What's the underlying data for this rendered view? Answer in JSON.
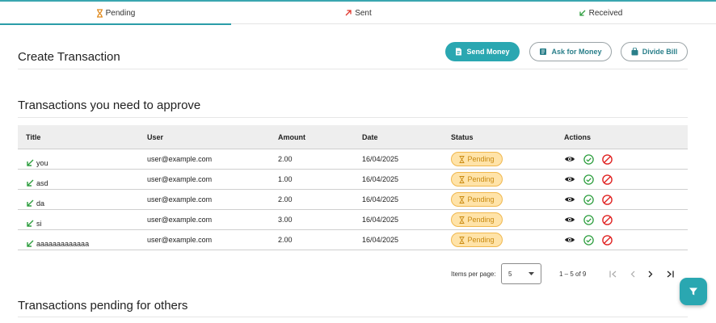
{
  "tabs": [
    {
      "label": "Pending",
      "icon": "hourglass-icon",
      "active": true
    },
    {
      "label": "Sent",
      "icon": "arrow-up-right-icon",
      "active": false
    },
    {
      "label": "Received",
      "icon": "arrow-down-left-icon",
      "active": false
    }
  ],
  "create": {
    "title": "Create Transaction",
    "send_label": "Send Money",
    "ask_label": "Ask for Money",
    "divide_label": "Divide Bill"
  },
  "approve": {
    "title": "Transactions you need to approve",
    "columns": [
      "Title",
      "User",
      "Amount",
      "Date",
      "Status",
      "Actions"
    ],
    "rows": [
      {
        "title": "you",
        "user": "user@example.com",
        "amount": "2.00",
        "date": "16/04/2025",
        "status": "Pending"
      },
      {
        "title": "asd",
        "user": "user@example.com",
        "amount": "1.00",
        "date": "16/04/2025",
        "status": "Pending"
      },
      {
        "title": "da",
        "user": "user@example.com",
        "amount": "2.00",
        "date": "16/04/2025",
        "status": "Pending"
      },
      {
        "title": "si",
        "user": "user@example.com",
        "amount": "3.00",
        "date": "16/04/2025",
        "status": "Pending"
      },
      {
        "title": "aaaaaaaaaaaaa",
        "user": "user@example.com",
        "amount": "2.00",
        "date": "16/04/2025",
        "status": "Pending"
      }
    ]
  },
  "pager": {
    "items_per_page_label": "Items per page:",
    "items_per_page_value": "5",
    "range": "1 – 5 of 9"
  },
  "others": {
    "title": "Transactions pending for others"
  },
  "colors": {
    "accent": "#2aa7b1",
    "pending_bg": "#ffe3a8",
    "pending_text": "#c98a10",
    "approve": "#2e9e3f",
    "reject": "#e02424",
    "received_arrow": "#2e9e3f",
    "sent_arrow": "#e0352b"
  }
}
